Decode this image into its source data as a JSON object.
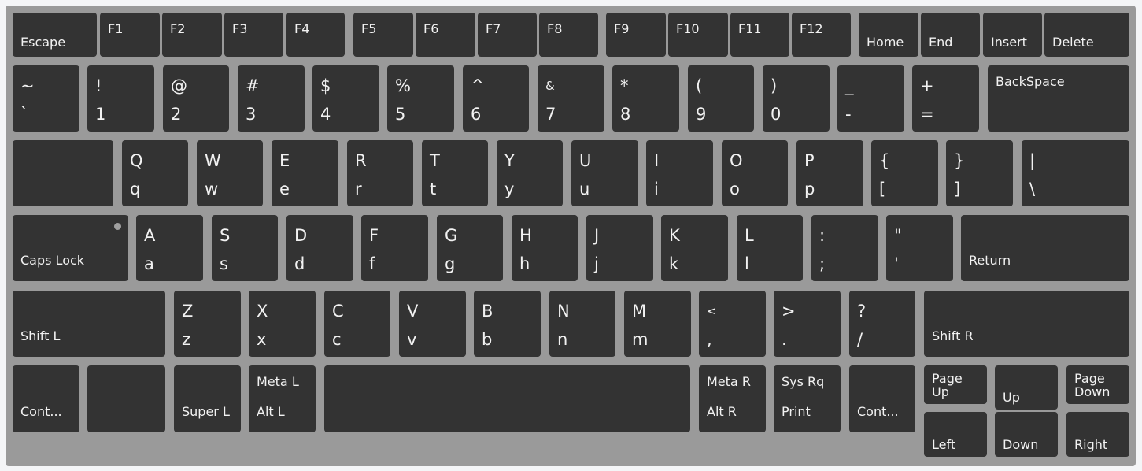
{
  "keyboard": {
    "colors": {
      "frame": "#9a9a9a",
      "key": "#333333",
      "text": "#f2f2f2",
      "led": "#a0a0a0"
    },
    "row_function": {
      "escape": "Escape",
      "f": [
        "F1",
        "F2",
        "F3",
        "F4",
        "F5",
        "F6",
        "F7",
        "F8",
        "F9",
        "F10",
        "F11",
        "F12"
      ],
      "home": "Home",
      "end": "End",
      "insert": "Insert",
      "delete": "Delete"
    },
    "row_number": {
      "keys": [
        {
          "shift": "~",
          "base": "`"
        },
        {
          "shift": "!",
          "base": "1"
        },
        {
          "shift": "@",
          "base": "2"
        },
        {
          "shift": "#",
          "base": "3"
        },
        {
          "shift": "$",
          "base": "4"
        },
        {
          "shift": "%",
          "base": "5"
        },
        {
          "shift": "^",
          "base": "6"
        },
        {
          "shift": "&",
          "base": "7"
        },
        {
          "shift": "*",
          "base": "8"
        },
        {
          "shift": "(",
          "base": "9"
        },
        {
          "shift": ")",
          "base": "0"
        },
        {
          "shift": "_",
          "base": "-"
        },
        {
          "shift": "+",
          "base": "="
        }
      ],
      "backspace": "BackSpace"
    },
    "row_qwerty": {
      "tab": "",
      "keys": [
        {
          "shift": "Q",
          "base": "q"
        },
        {
          "shift": "W",
          "base": "w"
        },
        {
          "shift": "E",
          "base": "e"
        },
        {
          "shift": "R",
          "base": "r"
        },
        {
          "shift": "T",
          "base": "t"
        },
        {
          "shift": "Y",
          "base": "y"
        },
        {
          "shift": "U",
          "base": "u"
        },
        {
          "shift": "I",
          "base": "i"
        },
        {
          "shift": "O",
          "base": "o"
        },
        {
          "shift": "P",
          "base": "p"
        },
        {
          "shift": "{",
          "base": "["
        },
        {
          "shift": "}",
          "base": "]"
        },
        {
          "shift": "|",
          "base": "\\"
        }
      ]
    },
    "row_home": {
      "caps_lock": "Caps Lock",
      "caps_lock_led_on": false,
      "keys": [
        {
          "shift": "A",
          "base": "a"
        },
        {
          "shift": "S",
          "base": "s"
        },
        {
          "shift": "D",
          "base": "d"
        },
        {
          "shift": "F",
          "base": "f"
        },
        {
          "shift": "G",
          "base": "g"
        },
        {
          "shift": "H",
          "base": "h"
        },
        {
          "shift": "J",
          "base": "j"
        },
        {
          "shift": "K",
          "base": "k"
        },
        {
          "shift": "L",
          "base": "l"
        },
        {
          "shift": ":",
          "base": ";"
        },
        {
          "shift": "\"",
          "base": "'"
        }
      ],
      "return": "Return"
    },
    "row_shift": {
      "shift_l": "Shift L",
      "keys": [
        {
          "shift": "Z",
          "base": "z"
        },
        {
          "shift": "X",
          "base": "x"
        },
        {
          "shift": "C",
          "base": "c"
        },
        {
          "shift": "V",
          "base": "v"
        },
        {
          "shift": "B",
          "base": "b"
        },
        {
          "shift": "N",
          "base": "n"
        },
        {
          "shift": "M",
          "base": "m"
        },
        {
          "shift": "<",
          "base": ","
        },
        {
          "shift": ">",
          "base": "."
        },
        {
          "shift": "?",
          "base": "/"
        }
      ],
      "shift_r": "Shift R"
    },
    "row_bottom": {
      "control_l": "Cont...",
      "blank": "",
      "super_l": "Super L",
      "meta_l": "Meta L",
      "alt_l": "Alt L",
      "space": "",
      "meta_r": "Meta R",
      "alt_r": "Alt R",
      "sysrq": "Sys Rq",
      "print": "Print",
      "control_r": "Cont...",
      "page_up": "Page Up",
      "up": "Up",
      "page_down": "Page Down",
      "left": "Left",
      "down": "Down",
      "right": "Right"
    }
  }
}
